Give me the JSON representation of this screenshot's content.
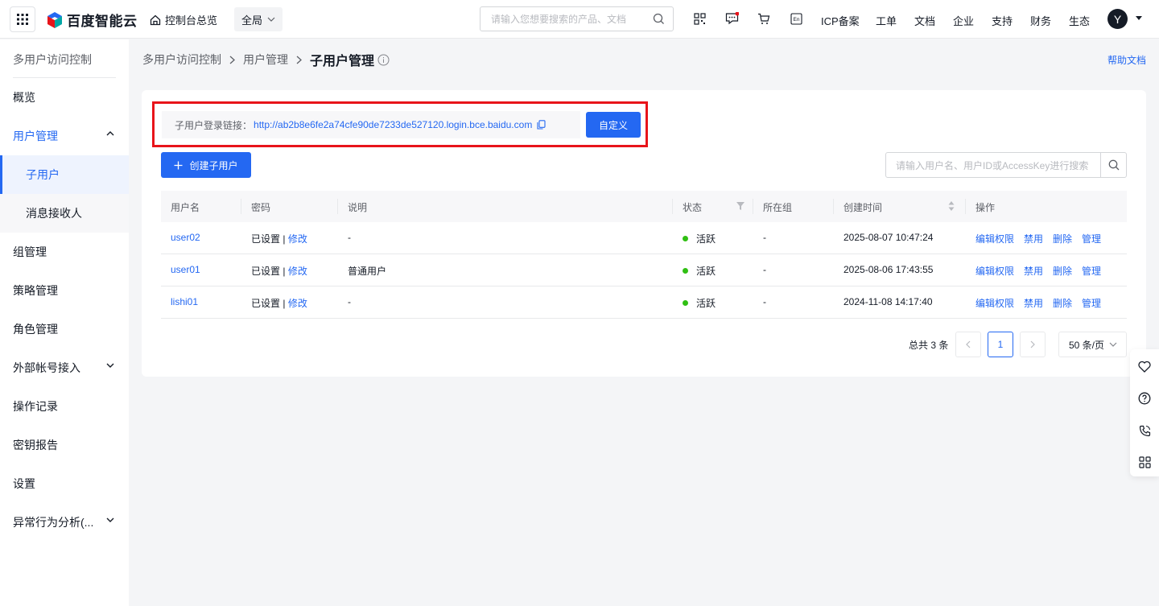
{
  "topbar": {
    "logo_text": "百度智能云",
    "home_label": "控制台总览",
    "region_label": "全局",
    "search_placeholder": "请输入您想要搜索的产品、文档",
    "nav": [
      "ICP备案",
      "工单",
      "文档",
      "企业",
      "支持",
      "财务",
      "生态"
    ],
    "avatar_initial": "Y",
    "icons": [
      "apps-grid-icon",
      "qrcode-icon",
      "message-icon",
      "cart-icon",
      "language-en-icon"
    ]
  },
  "sidebar": {
    "title": "多用户访问控制",
    "items": [
      {
        "label": "概览"
      },
      {
        "label": "用户管理"
      },
      {
        "label": "子用户"
      },
      {
        "label": "消息接收人"
      },
      {
        "label": "组管理"
      },
      {
        "label": "策略管理"
      },
      {
        "label": "角色管理"
      },
      {
        "label": "外部帐号接入"
      },
      {
        "label": "操作记录"
      },
      {
        "label": "密钥报告"
      },
      {
        "label": "设置"
      },
      {
        "label": "异常行为分析(..."
      }
    ]
  },
  "breadcrumb": {
    "items": [
      "多用户访问控制",
      "用户管理",
      "子用户管理"
    ],
    "help_doc": "帮助文档"
  },
  "login_link": {
    "label": "子用户登录链接：",
    "url": "http://ab2b8e6fe2a74cfe90de7233de527120.login.bce.baidu.com",
    "custom_button": "自定义"
  },
  "toolbar": {
    "create_button": "创建子用户",
    "search_placeholder": "请输入用户名、用户ID或AccessKey进行搜索"
  },
  "table": {
    "columns": [
      "用户名",
      "密码",
      "说明",
      "状态",
      "所在组",
      "创建时间",
      "操作"
    ],
    "rows": [
      {
        "username": "user02",
        "password": "已设置",
        "modify": "修改",
        "separator": " | ",
        "desc": "-",
        "status": "活跃",
        "group": "-",
        "created": "2025-08-07 10:47:24"
      },
      {
        "username": "user01",
        "password": "已设置",
        "modify": "修改",
        "separator": " | ",
        "desc": "普通用户",
        "status": "活跃",
        "group": "-",
        "created": "2025-08-06 17:43:55"
      },
      {
        "username": "lishi01",
        "password": "已设置",
        "modify": "修改",
        "separator": " | ",
        "desc": "-",
        "status": "活跃",
        "group": "-",
        "created": "2024-11-08 14:17:40"
      }
    ],
    "operations": [
      "编辑权限",
      "禁用",
      "删除",
      "管理"
    ]
  },
  "pagination": {
    "total_text": "总共 3 条",
    "current_page": "1",
    "page_size": "50 条/页"
  },
  "colors": {
    "accent": "#2468f2",
    "status_active": "#30bf13",
    "highlight": "#e8141a"
  }
}
